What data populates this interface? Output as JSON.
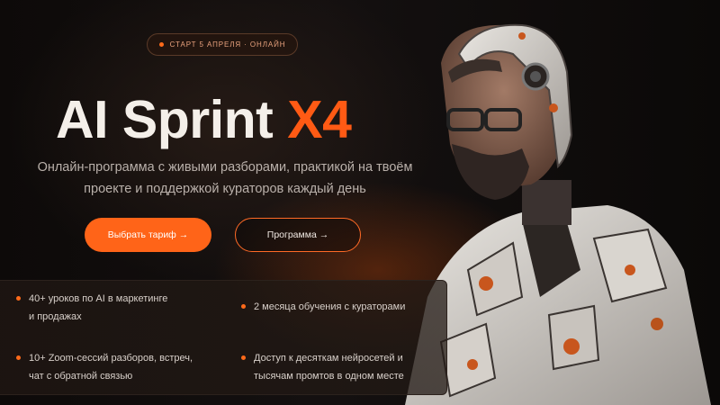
{
  "badge": {
    "text": "СТАРТ 5 АПРЕЛЯ · ОНЛАЙН",
    "icon": "dot-icon"
  },
  "hero": {
    "title_main": "AI Sprint",
    "title_accent": "X4",
    "subtitle_line1": "Онлайн-программа с живыми разборами, практикой на твоём",
    "subtitle_line2": "проекте и поддержкой кураторов каждый день"
  },
  "buttons": {
    "primary": "Выбрать тариф →",
    "secondary": "Программа →"
  },
  "features": [
    {
      "line1": "40+ уроков по AI в маркетинге",
      "line2": "и продажах"
    },
    {
      "line1": "2 месяца обучения с кураторами",
      "line2": ""
    },
    {
      "line1": "10+ Zoom-сессий разборов, встреч,",
      "line2": "чат с обратной связью"
    },
    {
      "line1": "Доступ к десяткам нейросетей и",
      "line2": "тысячам промтов в одном месте"
    }
  ],
  "colors": {
    "accent": "#ff5a14",
    "background": "#0a0807",
    "text": "#f4efe9"
  },
  "image": {
    "subject": "bearded man with glasses in cracked white-orange robotic armor"
  }
}
